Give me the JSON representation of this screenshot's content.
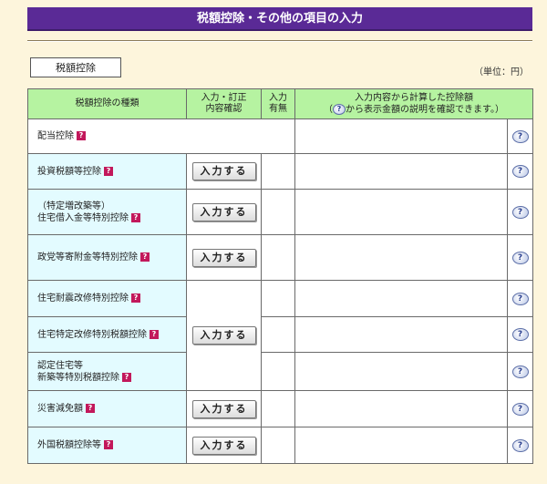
{
  "header": {
    "title": "税額控除・その他の項目の入力"
  },
  "tab": {
    "label": "税額控除"
  },
  "unit": "（単位：円）",
  "table": {
    "col_type": "税額控除の種類",
    "col_confirm_1": "入力・訂正",
    "col_confirm_2": "内容確認",
    "col_status_1": "入力",
    "col_status_2": "有無",
    "col_amount_1": "入力内容から計算した控除額",
    "col_amount_2a": "（",
    "col_amount_2b": "から表示金額の説明を確認できます。）",
    "help_glyph": "?",
    "rows": [
      {
        "line1": "配当控除",
        "line2": ""
      },
      {
        "line1": "投資税額等控除",
        "line2": ""
      },
      {
        "line1": "（特定増改築等）",
        "line2": "住宅借入金等特別控除"
      },
      {
        "line1": "政党等寄附金等特別控除",
        "line2": ""
      },
      {
        "line1": "住宅耐震改修特別控除",
        "line2": ""
      },
      {
        "line1": "住宅特定改修特別税額控除",
        "line2": ""
      },
      {
        "line1": "認定住宅等",
        "line2": "新築等特別税額控除"
      },
      {
        "line1": "災害減免額",
        "line2": ""
      },
      {
        "line1": "外国税額控除等",
        "line2": ""
      }
    ],
    "button_label": "入力する"
  },
  "icons": {
    "q_icon": "question-square-icon",
    "help_icon": "help-bubble-icon"
  },
  "colors": {
    "title_bg": "#5a2a96",
    "header_bg": "#b6f3a1",
    "name_bg": "#e3fbff",
    "q_icon": "#c2185b",
    "page_bg": "#fdf5dc"
  }
}
